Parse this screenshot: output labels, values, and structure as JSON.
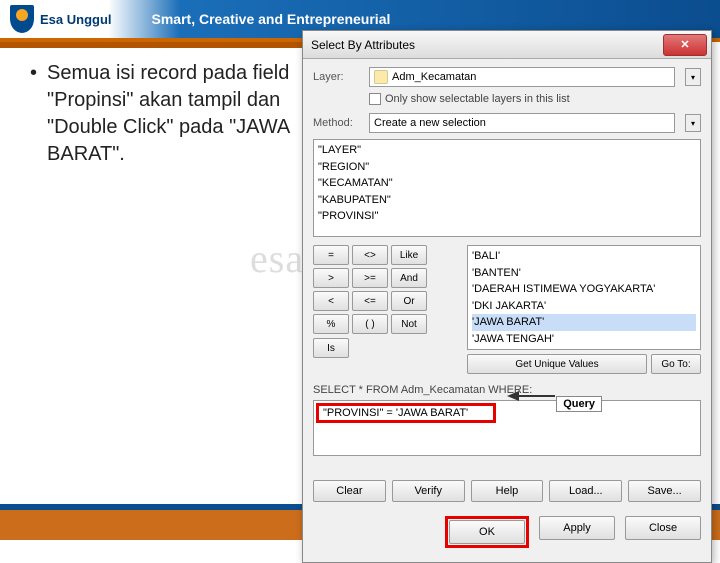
{
  "header": {
    "logo_name": "Esa Unggul",
    "slogan": "Smart, Creative and Entrepreneurial"
  },
  "slide": {
    "bullet": "Semua isi record pada field \"Propinsi\" akan tampil dan \"Double Click\" pada \"JAWA BARAT\"."
  },
  "watermark": "esaunggul.blogspot",
  "dialog": {
    "title": "Select By Attributes",
    "layer_label": "Layer:",
    "layer_value": "Adm_Kecamatan",
    "only_selectable": "Only show selectable layers in this list",
    "method_label": "Method:",
    "method_value": "Create a new selection",
    "fields": [
      "\"LAYER\"",
      "\"REGION\"",
      "\"KECAMATAN\"",
      "\"KABUPATEN\"",
      "\"PROVINSI\""
    ],
    "ops": {
      "eq": "=",
      "ne": "<>",
      "like": "Like",
      "gt": ">",
      "ge": ">=",
      "and": "And",
      "lt": "<",
      "le": "<=",
      "or": "Or",
      "pct": "%",
      "paren": "( )",
      "not": "Not",
      "is": "Is"
    },
    "values": [
      "'BALI'",
      "'BANTEN'",
      "'DAERAH ISTIMEWA YOGYAKARTA'",
      "'DKI JAKARTA'",
      "'JAWA BARAT'",
      "'JAWA TENGAH'"
    ],
    "get_unique": "Get Unique Values",
    "goto": "Go To:",
    "select_from": "SELECT * FROM Adm_Kecamatan WHERE:",
    "query_expr": "\"PROVINSI\" = 'JAWA BARAT'",
    "query_label": "Query",
    "buttons": {
      "clear": "Clear",
      "verify": "Verify",
      "help": "Help",
      "load": "Load...",
      "save": "Save...",
      "ok": "OK",
      "apply": "Apply",
      "close": "Close"
    }
  }
}
